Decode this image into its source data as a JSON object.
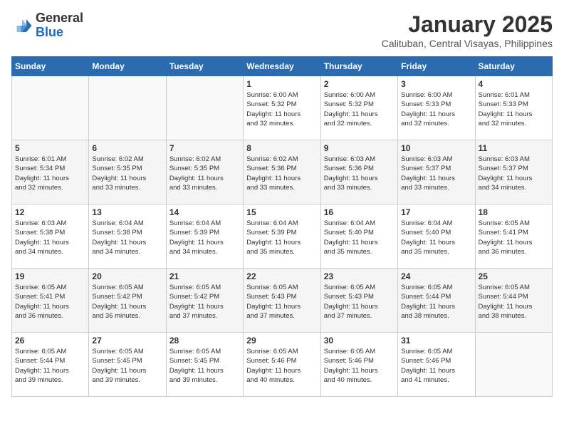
{
  "header": {
    "logo": {
      "general": "General",
      "blue": "Blue"
    },
    "title": "January 2025",
    "subtitle": "Calituban, Central Visayas, Philippines"
  },
  "calendar": {
    "weekdays": [
      "Sunday",
      "Monday",
      "Tuesday",
      "Wednesday",
      "Thursday",
      "Friday",
      "Saturday"
    ],
    "weeks": [
      [
        {
          "day": "",
          "info": ""
        },
        {
          "day": "",
          "info": ""
        },
        {
          "day": "",
          "info": ""
        },
        {
          "day": "1",
          "info": "Sunrise: 6:00 AM\nSunset: 5:32 PM\nDaylight: 11 hours\nand 32 minutes."
        },
        {
          "day": "2",
          "info": "Sunrise: 6:00 AM\nSunset: 5:32 PM\nDaylight: 11 hours\nand 32 minutes."
        },
        {
          "day": "3",
          "info": "Sunrise: 6:00 AM\nSunset: 5:33 PM\nDaylight: 11 hours\nand 32 minutes."
        },
        {
          "day": "4",
          "info": "Sunrise: 6:01 AM\nSunset: 5:33 PM\nDaylight: 11 hours\nand 32 minutes."
        }
      ],
      [
        {
          "day": "5",
          "info": "Sunrise: 6:01 AM\nSunset: 5:34 PM\nDaylight: 11 hours\nand 32 minutes."
        },
        {
          "day": "6",
          "info": "Sunrise: 6:02 AM\nSunset: 5:35 PM\nDaylight: 11 hours\nand 33 minutes."
        },
        {
          "day": "7",
          "info": "Sunrise: 6:02 AM\nSunset: 5:35 PM\nDaylight: 11 hours\nand 33 minutes."
        },
        {
          "day": "8",
          "info": "Sunrise: 6:02 AM\nSunset: 5:36 PM\nDaylight: 11 hours\nand 33 minutes."
        },
        {
          "day": "9",
          "info": "Sunrise: 6:03 AM\nSunset: 5:36 PM\nDaylight: 11 hours\nand 33 minutes."
        },
        {
          "day": "10",
          "info": "Sunrise: 6:03 AM\nSunset: 5:37 PM\nDaylight: 11 hours\nand 33 minutes."
        },
        {
          "day": "11",
          "info": "Sunrise: 6:03 AM\nSunset: 5:37 PM\nDaylight: 11 hours\nand 34 minutes."
        }
      ],
      [
        {
          "day": "12",
          "info": "Sunrise: 6:03 AM\nSunset: 5:38 PM\nDaylight: 11 hours\nand 34 minutes."
        },
        {
          "day": "13",
          "info": "Sunrise: 6:04 AM\nSunset: 5:38 PM\nDaylight: 11 hours\nand 34 minutes."
        },
        {
          "day": "14",
          "info": "Sunrise: 6:04 AM\nSunset: 5:39 PM\nDaylight: 11 hours\nand 34 minutes."
        },
        {
          "day": "15",
          "info": "Sunrise: 6:04 AM\nSunset: 5:39 PM\nDaylight: 11 hours\nand 35 minutes."
        },
        {
          "day": "16",
          "info": "Sunrise: 6:04 AM\nSunset: 5:40 PM\nDaylight: 11 hours\nand 35 minutes."
        },
        {
          "day": "17",
          "info": "Sunrise: 6:04 AM\nSunset: 5:40 PM\nDaylight: 11 hours\nand 35 minutes."
        },
        {
          "day": "18",
          "info": "Sunrise: 6:05 AM\nSunset: 5:41 PM\nDaylight: 11 hours\nand 36 minutes."
        }
      ],
      [
        {
          "day": "19",
          "info": "Sunrise: 6:05 AM\nSunset: 5:41 PM\nDaylight: 11 hours\nand 36 minutes."
        },
        {
          "day": "20",
          "info": "Sunrise: 6:05 AM\nSunset: 5:42 PM\nDaylight: 11 hours\nand 36 minutes."
        },
        {
          "day": "21",
          "info": "Sunrise: 6:05 AM\nSunset: 5:42 PM\nDaylight: 11 hours\nand 37 minutes."
        },
        {
          "day": "22",
          "info": "Sunrise: 6:05 AM\nSunset: 5:43 PM\nDaylight: 11 hours\nand 37 minutes."
        },
        {
          "day": "23",
          "info": "Sunrise: 6:05 AM\nSunset: 5:43 PM\nDaylight: 11 hours\nand 37 minutes."
        },
        {
          "day": "24",
          "info": "Sunrise: 6:05 AM\nSunset: 5:44 PM\nDaylight: 11 hours\nand 38 minutes."
        },
        {
          "day": "25",
          "info": "Sunrise: 6:05 AM\nSunset: 5:44 PM\nDaylight: 11 hours\nand 38 minutes."
        }
      ],
      [
        {
          "day": "26",
          "info": "Sunrise: 6:05 AM\nSunset: 5:44 PM\nDaylight: 11 hours\nand 39 minutes."
        },
        {
          "day": "27",
          "info": "Sunrise: 6:05 AM\nSunset: 5:45 PM\nDaylight: 11 hours\nand 39 minutes."
        },
        {
          "day": "28",
          "info": "Sunrise: 6:05 AM\nSunset: 5:45 PM\nDaylight: 11 hours\nand 39 minutes."
        },
        {
          "day": "29",
          "info": "Sunrise: 6:05 AM\nSunset: 5:46 PM\nDaylight: 11 hours\nand 40 minutes."
        },
        {
          "day": "30",
          "info": "Sunrise: 6:05 AM\nSunset: 5:46 PM\nDaylight: 11 hours\nand 40 minutes."
        },
        {
          "day": "31",
          "info": "Sunrise: 6:05 AM\nSunset: 5:46 PM\nDaylight: 11 hours\nand 41 minutes."
        },
        {
          "day": "",
          "info": ""
        }
      ]
    ]
  }
}
